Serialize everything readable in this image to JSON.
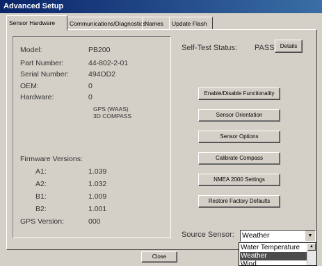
{
  "window": {
    "title": "Advanced Setup"
  },
  "tabs": [
    {
      "label": "Sensor Hardware"
    },
    {
      "label": "Communications/Diagnostics"
    },
    {
      "label": "Names"
    },
    {
      "label": "Update Flash"
    }
  ],
  "info": {
    "model_label": "Model:",
    "model_value": "PB200",
    "part_label": "Part Number:",
    "part_value": "44-802-2-01",
    "serial_label": "Serial Number:",
    "serial_value": "494OD2",
    "oem_label": "OEM:",
    "oem_value": "0",
    "hardware_label": "Hardware:",
    "hardware_value": "0",
    "hardware_line1": "GPS (WAAS)",
    "hardware_line2": "3D COMPASS",
    "firmware_label": "Firmware Versions:",
    "a1_label": "A1:",
    "a1_value": "1.039",
    "a2_label": "A2:",
    "a2_value": "1.032",
    "b1_label": "B1:",
    "b1_value": "1.009",
    "b2_label": "B2:",
    "b2_value": "1.001",
    "gps_label": "GPS Version:",
    "gps_value": "000"
  },
  "selftest": {
    "label": "Self-Test Status:",
    "value": "PASS",
    "details": "Details"
  },
  "buttons": {
    "enable": "Enable/Disable Functionality",
    "orientation": "Sensor Orientation",
    "options": "Sensor Options",
    "compass": "Calibrate Compass",
    "nmea": "NMEA 2000 Settings",
    "restore": "Restore Factory Defaults",
    "close": "Close"
  },
  "source": {
    "label": "Source Sensor:",
    "selected": "Weather",
    "options": [
      "Water Temperature",
      "Weather",
      "Wind"
    ]
  }
}
